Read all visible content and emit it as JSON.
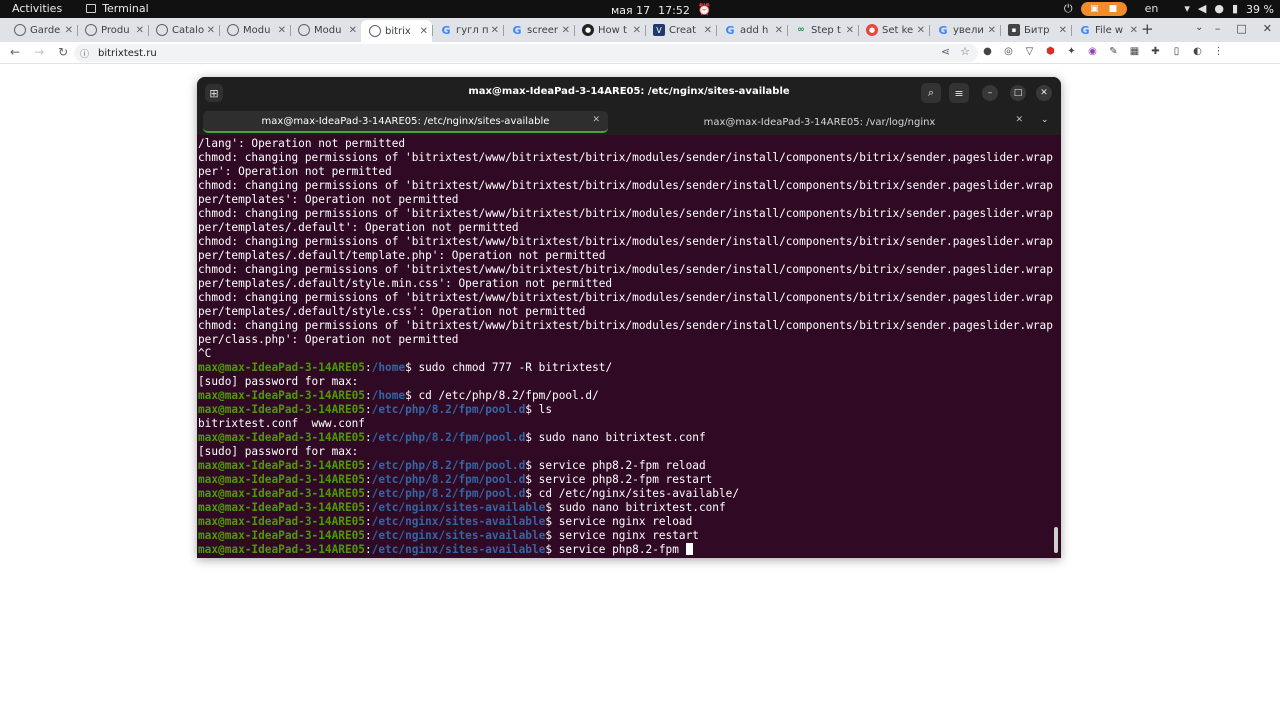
{
  "topbar": {
    "activities": "Activities",
    "app_name": "Terminal",
    "date": "мая 17",
    "time": "17:52",
    "lang": "en",
    "battery": "39 %"
  },
  "browser": {
    "tabs": [
      {
        "title": "Garde",
        "icon": "globe"
      },
      {
        "title": "Produ",
        "icon": "globe"
      },
      {
        "title": "Catalo",
        "icon": "globe"
      },
      {
        "title": "Modu",
        "icon": "globe"
      },
      {
        "title": "Modu",
        "icon": "globe"
      },
      {
        "title": "bitrix",
        "icon": "globe",
        "active": true
      },
      {
        "title": "гугл п",
        "icon": "g"
      },
      {
        "title": "screer",
        "icon": "g"
      },
      {
        "title": "How t",
        "icon": "dark"
      },
      {
        "title": "Creat",
        "icon": "navy"
      },
      {
        "title": "add h",
        "icon": "g"
      },
      {
        "title": "Step t",
        "icon": "green"
      },
      {
        "title": "Set ke",
        "icon": "red"
      },
      {
        "title": "увели",
        "icon": "g"
      },
      {
        "title": "Битр",
        "icon": "sq"
      },
      {
        "title": "File w",
        "icon": "g"
      }
    ],
    "url": "bitrixtest.ru"
  },
  "terminal": {
    "title": "max@max-IdeaPad-3-14ARE05: /etc/nginx/sites-available",
    "tabs": [
      {
        "label": "max@max-IdeaPad-3-14ARE05: /etc/nginx/sites-available"
      },
      {
        "label": "max@max-IdeaPad-3-14ARE05: /var/log/nginx"
      }
    ],
    "lines": [
      {
        "text": "/lang': Operation not permitted"
      },
      {
        "text": "chmod: changing permissions of 'bitrixtest/www/bitrixtest/bitrix/modules/sender/install/components/bitrix/sender.pageslider.wrap"
      },
      {
        "text": "per': Operation not permitted"
      },
      {
        "text": "chmod: changing permissions of 'bitrixtest/www/bitrixtest/bitrix/modules/sender/install/components/bitrix/sender.pageslider.wrap"
      },
      {
        "text": "per/templates': Operation not permitted"
      },
      {
        "text": "chmod: changing permissions of 'bitrixtest/www/bitrixtest/bitrix/modules/sender/install/components/bitrix/sender.pageslider.wrap"
      },
      {
        "text": "per/templates/.default': Operation not permitted"
      },
      {
        "text": "chmod: changing permissions of 'bitrixtest/www/bitrixtest/bitrix/modules/sender/install/components/bitrix/sender.pageslider.wrap"
      },
      {
        "text": "per/templates/.default/template.php': Operation not permitted"
      },
      {
        "text": "chmod: changing permissions of 'bitrixtest/www/bitrixtest/bitrix/modules/sender/install/components/bitrix/sender.pageslider.wrap"
      },
      {
        "text": "per/templates/.default/style.min.css': Operation not permitted"
      },
      {
        "text": "chmod: changing permissions of 'bitrixtest/www/bitrixtest/bitrix/modules/sender/install/components/bitrix/sender.pageslider.wrap"
      },
      {
        "text": "per/templates/.default/style.css': Operation not permitted"
      },
      {
        "text": "chmod: changing permissions of 'bitrixtest/www/bitrixtest/bitrix/modules/sender/install/components/bitrix/sender.pageslider.wrap"
      },
      {
        "text": "per/class.php': Operation not permitted"
      },
      {
        "text": "^C"
      },
      {
        "user": "max@max-IdeaPad-3-14ARE05",
        "path": "/home",
        "cmd": "sudo chmod 777 -R bitrixtest/"
      },
      {
        "text": "[sudo] password for max:"
      },
      {
        "user": "max@max-IdeaPad-3-14ARE05",
        "path": "/home",
        "cmd": "cd /etc/php/8.2/fpm/pool.d/"
      },
      {
        "user": "max@max-IdeaPad-3-14ARE05",
        "path": "/etc/php/8.2/fpm/pool.d",
        "cmd": "ls"
      },
      {
        "text": "bitrixtest.conf  www.conf"
      },
      {
        "user": "max@max-IdeaPad-3-14ARE05",
        "path": "/etc/php/8.2/fpm/pool.d",
        "cmd": "sudo nano bitrixtest.conf"
      },
      {
        "text": "[sudo] password for max:"
      },
      {
        "user": "max@max-IdeaPad-3-14ARE05",
        "path": "/etc/php/8.2/fpm/pool.d",
        "cmd": "service php8.2-fpm reload"
      },
      {
        "user": "max@max-IdeaPad-3-14ARE05",
        "path": "/etc/php/8.2/fpm/pool.d",
        "cmd": "service php8.2-fpm restart"
      },
      {
        "user": "max@max-IdeaPad-3-14ARE05",
        "path": "/etc/php/8.2/fpm/pool.d",
        "cmd": "cd /etc/nginx/sites-available/"
      },
      {
        "user": "max@max-IdeaPad-3-14ARE05",
        "path": "/etc/nginx/sites-available",
        "cmd": "sudo nano bitrixtest.conf"
      },
      {
        "user": "max@max-IdeaPad-3-14ARE05",
        "path": "/etc/nginx/sites-available",
        "cmd": "service nginx reload"
      },
      {
        "user": "max@max-IdeaPad-3-14ARE05",
        "path": "/etc/nginx/sites-available",
        "cmd": "service nginx restart"
      },
      {
        "user": "max@max-IdeaPad-3-14ARE05",
        "path": "/etc/nginx/sites-available",
        "cmd": "service php8.2-fpm ",
        "cursor": true
      }
    ]
  },
  "colors": {
    "terminal_bg": "#300a24",
    "prompt_user": "#4e9a06",
    "prompt_path": "#3465a4",
    "accent": "#f28b2a"
  }
}
